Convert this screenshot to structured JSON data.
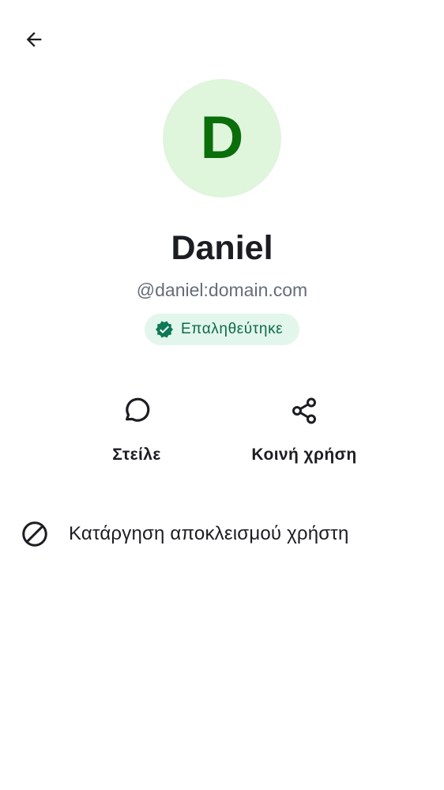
{
  "header": {
    "back_icon": "arrow-left-icon"
  },
  "profile": {
    "avatar_initial": "D",
    "display_name": "Daniel",
    "user_id": "@daniel:domain.com",
    "verified_badge": {
      "icon": "verified-check-icon",
      "label": "Επαληθεύτηκε"
    }
  },
  "actions": [
    {
      "icon": "chat-bubble-icon",
      "label": "Στείλε"
    },
    {
      "icon": "share-icon",
      "label": "Κοινή χρήση"
    }
  ],
  "options": [
    {
      "icon": "block-icon",
      "label": "Κατάργηση αποκλεισμού χρήστη"
    }
  ],
  "colors": {
    "avatar_background": "#dff5dc",
    "avatar_text": "#0a6e0a",
    "badge_background": "#e3f6ec",
    "badge_text": "#0b6b4a",
    "badge_icon": "#0b7a55",
    "primary_text": "#1b1d22",
    "secondary_text": "#656d77"
  }
}
